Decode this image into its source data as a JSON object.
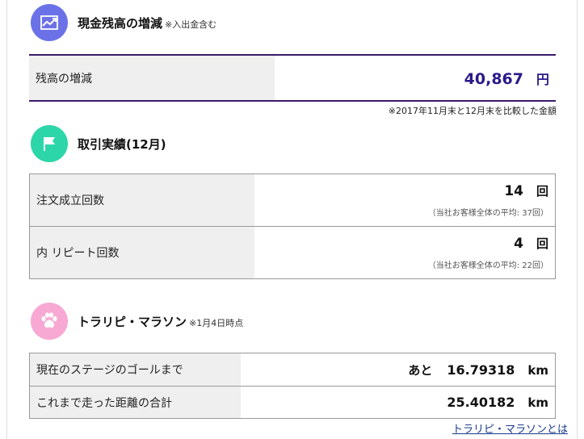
{
  "colors": {
    "cash_icon_bg": "#6b72e8",
    "trade_icon_bg": "#2dd6a8",
    "marathon_icon_bg": "#f7a8d3",
    "value_text": "#2a1a8a",
    "link": "#1a3a8a"
  },
  "cash": {
    "icon": "trend-chart-icon",
    "title": "現金残高の増減",
    "note": "※入出金含む",
    "label": "残高の増減",
    "value": "40,867",
    "unit": "円",
    "compare_note": "※2017年11月末と12月末を比較した金額"
  },
  "trades": {
    "icon": "flag-icon",
    "title": "取引実績(12月)",
    "rows": [
      {
        "label": "注文成立回数",
        "value": "14",
        "unit": "回",
        "sub": "（当社お客様全体の平均: 37回）"
      },
      {
        "label": "内 リピート回数",
        "value": "4",
        "unit": "回",
        "sub": "（当社お客様全体の平均: 22回）"
      }
    ]
  },
  "marathon": {
    "icon": "paw-icon",
    "title": "トラリピ・マラソン",
    "note": "※1月4日時点",
    "rows": [
      {
        "label": "現在のステージのゴールまで",
        "prefix": "あと",
        "value": "16.79318",
        "unit": "km"
      },
      {
        "label": "これまで走った距離の合計",
        "value": "25.40182",
        "unit": "km"
      }
    ],
    "link": "トラリピ・マラソンとは"
  }
}
